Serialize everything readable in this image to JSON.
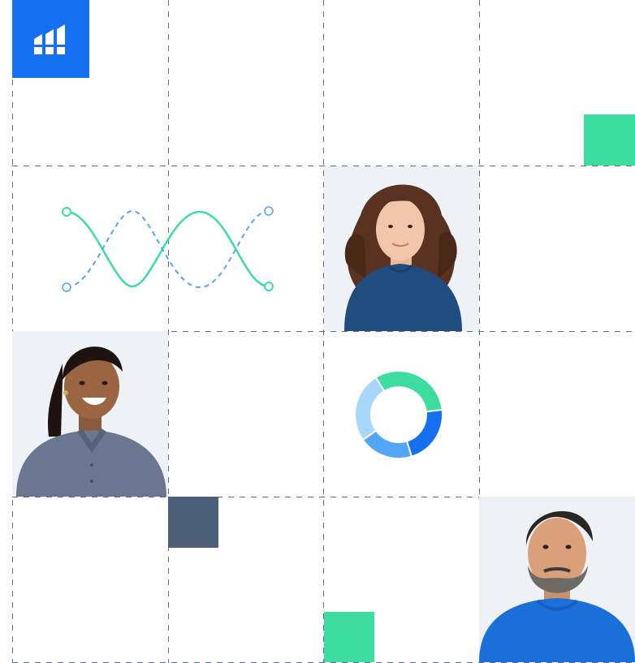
{
  "scene": {
    "description_hidden": "",
    "colors": {
      "brand_blue": "#1570ef",
      "accent_green": "#3ddc9f",
      "slate": "#4b5f7b",
      "grid_line": "#5c6f8a",
      "photo_bg": "#eef2f6"
    },
    "icons": {
      "logo": "bar-chart-logo-icon",
      "wave": "crossing-curves-icon",
      "donut": "donut-chart-icon"
    },
    "donut_segments": [
      {
        "color": "#3ddc9f",
        "fraction": 0.32
      },
      {
        "color": "#1570ef",
        "fraction": 0.22
      },
      {
        "color": "#53a5f5",
        "fraction": 0.2
      },
      {
        "color": "#a7d8fb",
        "fraction": 0.26
      }
    ]
  }
}
